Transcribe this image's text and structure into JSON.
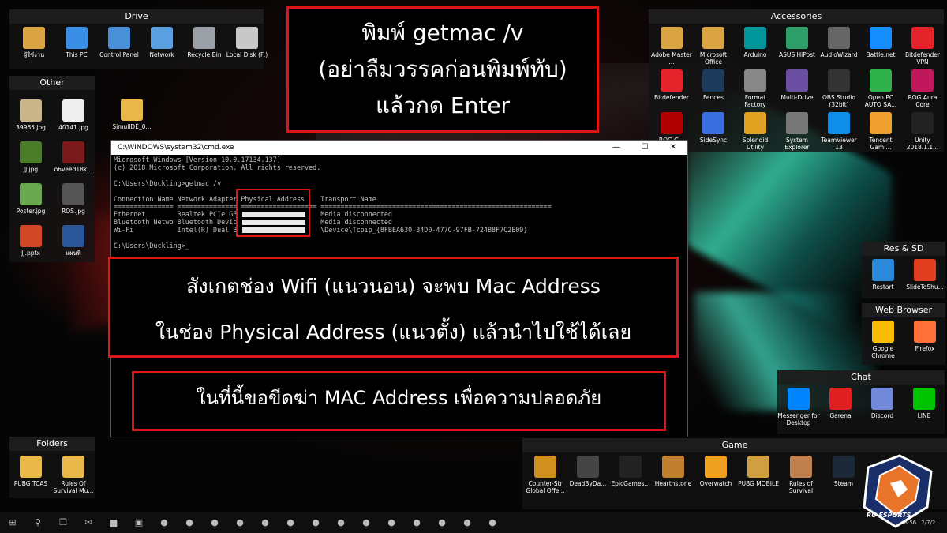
{
  "colors": {
    "annotation_border": "#e01616",
    "accent_teal": "#3de6c0"
  },
  "fences": {
    "drive": {
      "title": "Drive",
      "items": [
        {
          "label": "ผู้ใช้งาน",
          "icon": "user-folder-icon",
          "color": "#d9a441"
        },
        {
          "label": "This PC",
          "icon": "computer-icon",
          "color": "#3a8ee6"
        },
        {
          "label": "Control Panel",
          "icon": "control-panel-icon",
          "color": "#4a90d9"
        },
        {
          "label": "Network",
          "icon": "network-icon",
          "color": "#5aa0e0"
        },
        {
          "label": "Recycle Bin",
          "icon": "recycle-bin-icon",
          "color": "#9aa0a6"
        },
        {
          "label": "Local Disk (F:)",
          "icon": "disk-icon",
          "color": "#c8c8c8"
        }
      ]
    },
    "other": {
      "title": "Other",
      "items": [
        {
          "label": "39965.jpg",
          "icon": "image-file-icon",
          "color": "#c9b58a"
        },
        {
          "label": "40141.jpg",
          "icon": "image-file-icon",
          "color": "#eeeeee"
        },
        {
          "label": "JJ.jpg",
          "icon": "image-file-icon",
          "color": "#4a7c2a"
        },
        {
          "label": "o6veed18k...",
          "icon": "image-file-icon",
          "color": "#7a1a1a"
        },
        {
          "label": "Poster.jpg",
          "icon": "image-file-icon",
          "color": "#6aa84f"
        },
        {
          "label": "ROS.jpg",
          "icon": "image-file-icon",
          "color": "#555555"
        },
        {
          "label": "JJ.pptx",
          "icon": "powerpoint-icon",
          "color": "#d24726"
        },
        {
          "label": "แผนที่",
          "icon": "word-icon",
          "color": "#2b579a"
        }
      ]
    },
    "loose_item": {
      "label": "SimullDE_0...",
      "icon": "folder-icon",
      "color": "#e8b84a"
    },
    "folders": {
      "title": "Folders",
      "items": [
        {
          "label": "PUBG TCAS",
          "icon": "folder-icon",
          "color": "#e8b84a"
        },
        {
          "label": "Rules Of Survival Mu...",
          "icon": "folder-icon",
          "color": "#e8b84a"
        }
      ]
    },
    "accessories": {
      "title": "Accessories",
      "items": [
        {
          "label": "Adobe Master ...",
          "icon": "adobe-icon",
          "color": "#d9a441"
        },
        {
          "label": "Microsoft Office",
          "icon": "office-icon",
          "color": "#d9a441"
        },
        {
          "label": "Arduino",
          "icon": "arduino-icon",
          "color": "#00979c"
        },
        {
          "label": "ASUS HiPost",
          "icon": "asus-icon",
          "color": "#2e9e6b"
        },
        {
          "label": "AudioWizard",
          "icon": "audio-icon",
          "color": "#666666"
        },
        {
          "label": "Battle.net",
          "icon": "battlenet-icon",
          "color": "#148eff"
        },
        {
          "label": "Bitdefender VPN",
          "icon": "vpn-icon",
          "color": "#e5232a"
        },
        {
          "label": "Bitdefender",
          "icon": "bitdefender-icon",
          "color": "#e5232a"
        },
        {
          "label": "Fences",
          "icon": "fences-icon",
          "color": "#1b3a5c"
        },
        {
          "label": "Format Factory",
          "icon": "format-factory-icon",
          "color": "#888888"
        },
        {
          "label": "Multi-Drive",
          "icon": "multi-drive-icon",
          "color": "#6a4fa3"
        },
        {
          "label": "OBS Studio (32bit)",
          "icon": "obs-icon",
          "color": "#333333"
        },
        {
          "label": "Open PC AUTO SA...",
          "icon": "wifi-icon",
          "color": "#2db34a"
        },
        {
          "label": "ROG Aura Core",
          "icon": "rog-icon",
          "color": "#c0185a"
        },
        {
          "label": "ROG G...",
          "icon": "rog-gaming-icon",
          "color": "#b00000"
        },
        {
          "label": "SideSync",
          "icon": "sidesync-icon",
          "color": "#3b6fe0"
        },
        {
          "label": "Splendid Utility",
          "icon": "splendid-icon",
          "color": "#e0a020"
        },
        {
          "label": "System Explorer",
          "icon": "system-explorer-icon",
          "color": "#777777"
        },
        {
          "label": "TeamViewer 13",
          "icon": "teamviewer-icon",
          "color": "#0e8ee9"
        },
        {
          "label": "Tencent Gami...",
          "icon": "tencent-icon",
          "color": "#f0a030"
        },
        {
          "label": "Unity 2018.1.1...",
          "icon": "unity-icon",
          "color": "#222222"
        }
      ]
    },
    "res_sd": {
      "title": "Res & SD",
      "items": [
        {
          "label": "Restart",
          "icon": "restart-icon",
          "color": "#2a8ad9"
        },
        {
          "label": "SlideToShu...",
          "icon": "shutdown-icon",
          "color": "#e04020"
        }
      ]
    },
    "web_browser": {
      "title": "Web Browser",
      "items": [
        {
          "label": "Google Chrome",
          "icon": "chrome-icon",
          "color": "#fbbc05"
        },
        {
          "label": "Firefox",
          "icon": "firefox-icon",
          "color": "#ff7139"
        }
      ]
    },
    "chat": {
      "title": "Chat",
      "items": [
        {
          "label": "Messenger for Desktop",
          "icon": "messenger-icon",
          "color": "#0084ff"
        },
        {
          "label": "Garena",
          "icon": "garena-icon",
          "color": "#e02020"
        },
        {
          "label": "Discord",
          "icon": "discord-icon",
          "color": "#7289da"
        },
        {
          "label": "LINE",
          "icon": "line-icon",
          "color": "#00c300"
        }
      ]
    },
    "game": {
      "title": "Game",
      "items": [
        {
          "label": "Counter-Str Global Offe...",
          "icon": "csgo-icon",
          "color": "#d09020"
        },
        {
          "label": "DeadByDa...",
          "icon": "dbd-icon",
          "color": "#444444"
        },
        {
          "label": "EpicGames...",
          "icon": "epic-icon",
          "color": "#222222"
        },
        {
          "label": "Hearthstone",
          "icon": "hearthstone-icon",
          "color": "#c08030"
        },
        {
          "label": "Overwatch",
          "icon": "overwatch-icon",
          "color": "#f0a020"
        },
        {
          "label": "PUBG MOBILE",
          "icon": "pubg-icon",
          "color": "#d0a040"
        },
        {
          "label": "Rules of Survival",
          "icon": "ros-icon",
          "color": "#c08050"
        },
        {
          "label": "Steam",
          "icon": "steam-icon",
          "color": "#1b2838"
        }
      ]
    }
  },
  "notes": {
    "top": [
      "พิมพ์ getmac /v",
      "(อย่าลืมวรรคก่อนพิมพ์ทับ)",
      "แล้วกด Enter"
    ],
    "middle": [
      "สังเกตช่อง Wifi (แนวนอน) จะพบ Mac Address",
      "ในช่อง Physical Address (แนวตั้ง) แล้วนำไปใช้ได้เลย"
    ],
    "bottom": "ในที่นี้ขอขีดฆ่า MAC Address เพื่อความปลอดภัย"
  },
  "cmd": {
    "title": "C:\\WINDOWS\\system32\\cmd.exe",
    "lines": [
      "Microsoft Windows [Version 10.0.17134.137]",
      "(c) 2018 Microsoft Corporation. All rights reserved.",
      "",
      "C:\\Users\\Duckling>getmac /v",
      "",
      "Connection Name Network Adapter Physical Address    Transport Name",
      "=============== =============== =================== ==========================================================",
      "Ethernet        Realtek PCIe GB                     Media disconnected",
      "Bluetooth Netwo Bluetooth Devic                     Media disconnected",
      "Wi-Fi           Intel(R) Dual B                     \\Device\\Tcpip_{8FBEA630-34D0-477C-97FB-724B8F7C2E09}",
      "",
      "C:\\Users\\Duckling>_"
    ]
  },
  "taskbar": {
    "icons": [
      "windows-start-icon",
      "search-icon",
      "task-view-icon",
      "mail-icon",
      "file-explorer-icon",
      "store-icon",
      "vs-icon",
      "firefox-icon",
      "chrome-icon",
      "messenger-icon",
      "discord-icon",
      "line-icon",
      "teamviewer-icon",
      "garena-icon",
      "nox-icon",
      "game-icon",
      "steam-icon",
      "obs-icon",
      "nox-app-icon",
      "cmd-icon"
    ],
    "time": "18:56",
    "date": "2/7/2..."
  },
  "logo_text": "RU ESPORTS"
}
